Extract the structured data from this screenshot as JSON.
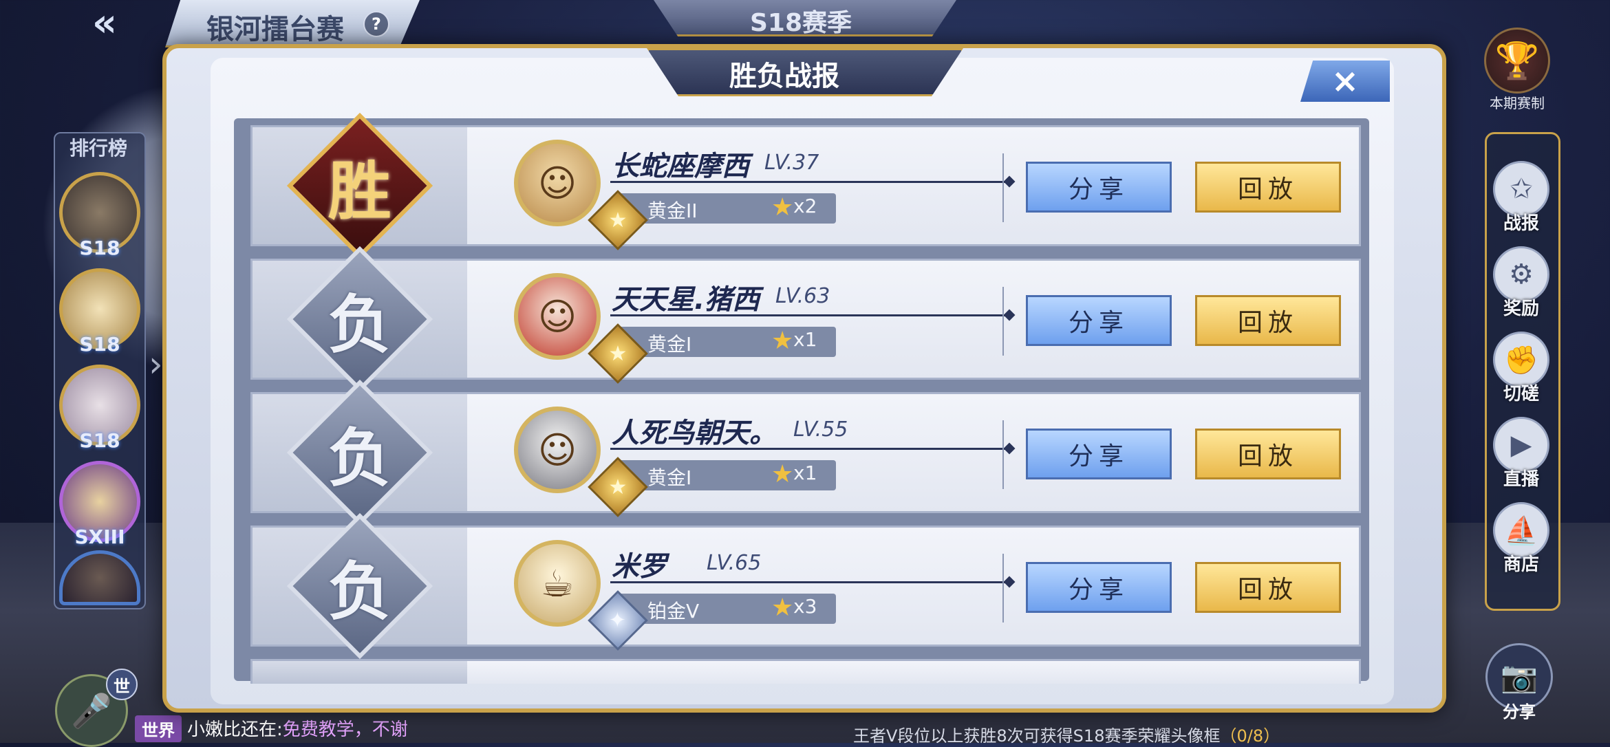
{
  "header": {
    "title": "银河擂台赛",
    "help_icon": "?",
    "season": "S18赛季",
    "back_icon": "«"
  },
  "leaderboard": {
    "title": "排行榜",
    "entries": [
      {
        "badge": "S18",
        "icon": "avatar-1"
      },
      {
        "badge": "S18",
        "icon": "avatar-2"
      },
      {
        "badge": "S18",
        "icon": "avatar-3"
      },
      {
        "badge": "SXIII",
        "icon": "avatar-4"
      },
      {
        "badge": "",
        "icon": "avatar-5"
      }
    ],
    "expand_icon": "›"
  },
  "right_menu": {
    "rules": {
      "icon": "🏆",
      "label": "本期赛制"
    },
    "items": [
      {
        "id": "battle-report",
        "icon": "✩",
        "label": "战报"
      },
      {
        "id": "rewards",
        "icon": "⚙",
        "label": "奖励"
      },
      {
        "id": "spar",
        "icon": "✊",
        "label": "切磋"
      },
      {
        "id": "live",
        "icon": "▶",
        "label": "直播"
      },
      {
        "id": "shop",
        "icon": "⛵",
        "label": "商店"
      }
    ],
    "share": {
      "icon": "📷",
      "label": "分享"
    }
  },
  "modal": {
    "title": "胜负战报",
    "close_icon": "×",
    "share_label": "分享",
    "replay_label": "回放",
    "records": [
      {
        "result": "胜",
        "result_type": "win",
        "name": "长蛇座摩西",
        "level": "LV.37",
        "rank": "黄金II",
        "rank_tier": "gold",
        "stars": "x2",
        "avatar": "☺"
      },
      {
        "result": "负",
        "result_type": "loss",
        "name": "天天星.猪西",
        "level": "LV.63",
        "rank": "黄金I",
        "rank_tier": "gold",
        "stars": "x1",
        "avatar": "☺"
      },
      {
        "result": "负",
        "result_type": "loss",
        "name": "人死鸟朝天。",
        "level": "LV.55",
        "rank": "黄金I",
        "rank_tier": "gold",
        "stars": "x1",
        "avatar": "☺"
      },
      {
        "result": "负",
        "result_type": "loss",
        "name": "米罗",
        "level": "LV.65",
        "rank": "铂金V",
        "rank_tier": "platinum",
        "stars": "x3",
        "avatar": "☕"
      }
    ]
  },
  "chat": {
    "world_badge": "世",
    "mic_icon": "🎤",
    "channel": "世界",
    "sender": "小嫩比还在:",
    "message": "免费教学，不谢"
  },
  "footer_note": {
    "text": "王者V段位以上获胜8次可获得S18赛季荣耀头像框",
    "progress": "（0/8）"
  },
  "colors": {
    "gold": "#c9a24a",
    "share_blue": "#6ea0ee",
    "replay_gold": "#e9b84a",
    "win_red": "#7a2020"
  }
}
